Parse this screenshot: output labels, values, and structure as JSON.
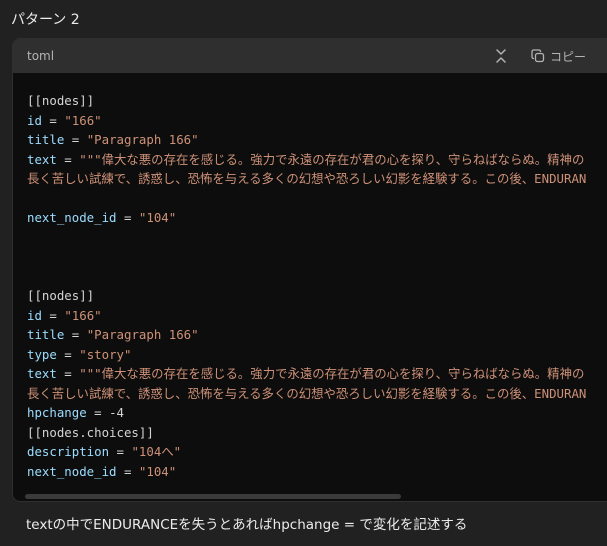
{
  "heading": "パターン 2",
  "code": {
    "language": "toml",
    "copy_label": "コピー",
    "lines": [
      [
        {
          "t": "p",
          "v": "[[nodes]]"
        }
      ],
      [
        {
          "t": "k",
          "v": "id"
        },
        {
          "t": "p",
          "v": " = "
        },
        {
          "t": "s",
          "v": "\"166\""
        }
      ],
      [
        {
          "t": "k",
          "v": "title"
        },
        {
          "t": "p",
          "v": " = "
        },
        {
          "t": "s",
          "v": "\"Paragraph 166\""
        }
      ],
      [
        {
          "t": "k",
          "v": "text"
        },
        {
          "t": "p",
          "v": " = "
        },
        {
          "t": "s",
          "v": "\"\"\"偉大な悪の存在を感じる。強力で永遠の存在が君の心を探り、守らねばならぬ。精神の"
        }
      ],
      [
        {
          "t": "s",
          "v": "長く苦しい試練で、誘惑し、恐怖を与える多くの幻想や恐ろしい幻影を経験する。この後、ENDURAN"
        }
      ],
      [
        {
          "t": "p",
          "v": ""
        }
      ],
      [
        {
          "t": "k",
          "v": "next_node_id"
        },
        {
          "t": "p",
          "v": " = "
        },
        {
          "t": "s",
          "v": "\"104\""
        }
      ],
      [
        {
          "t": "p",
          "v": ""
        }
      ],
      [
        {
          "t": "p",
          "v": ""
        }
      ],
      [
        {
          "t": "p",
          "v": ""
        }
      ],
      [
        {
          "t": "p",
          "v": "[[nodes]]"
        }
      ],
      [
        {
          "t": "k",
          "v": "id"
        },
        {
          "t": "p",
          "v": " = "
        },
        {
          "t": "s",
          "v": "\"166\""
        }
      ],
      [
        {
          "t": "k",
          "v": "title"
        },
        {
          "t": "p",
          "v": " = "
        },
        {
          "t": "s",
          "v": "\"Paragraph 166\""
        }
      ],
      [
        {
          "t": "k",
          "v": "type"
        },
        {
          "t": "p",
          "v": " = "
        },
        {
          "t": "s",
          "v": "\"story\""
        }
      ],
      [
        {
          "t": "k",
          "v": "text"
        },
        {
          "t": "p",
          "v": " = "
        },
        {
          "t": "s",
          "v": "\"\"\"偉大な悪の存在を感じる。強力で永遠の存在が君の心を探り、守らねばならぬ。精神の"
        }
      ],
      [
        {
          "t": "s",
          "v": "長く苦しい試練で、誘惑し、恐怖を与える多くの幻想や恐ろしい幻影を経験する。この後、ENDURAN"
        }
      ],
      [
        {
          "t": "k",
          "v": "hpchange"
        },
        {
          "t": "p",
          "v": " = -4"
        }
      ],
      [
        {
          "t": "p",
          "v": "[[nodes.choices]]"
        }
      ],
      [
        {
          "t": "k",
          "v": "description"
        },
        {
          "t": "p",
          "v": " = "
        },
        {
          "t": "s",
          "v": "\"104へ\""
        }
      ],
      [
        {
          "t": "k",
          "v": "next_node_id"
        },
        {
          "t": "p",
          "v": " = "
        },
        {
          "t": "s",
          "v": "\"104\""
        }
      ]
    ]
  },
  "footer_text": "textの中でENDURANCEを失うとあればhpchange = で変化を記述する",
  "icons": {
    "collapse": "collapse-icon",
    "copy": "copy-icon"
  },
  "colors": {
    "background": "#212121",
    "code_background": "#0d0d0d",
    "header_background": "#2f2f2f",
    "key": "#9cdcfe",
    "string": "#ce9178"
  }
}
